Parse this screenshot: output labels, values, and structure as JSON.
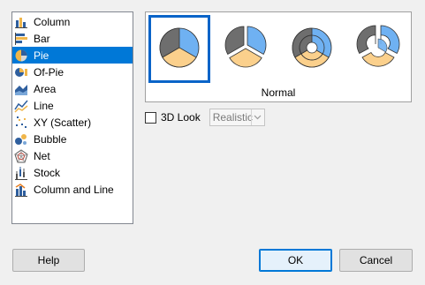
{
  "chart_types": [
    {
      "label": "Column",
      "icon": "column-chart-icon",
      "selected": false
    },
    {
      "label": "Bar",
      "icon": "bar-chart-icon",
      "selected": false
    },
    {
      "label": "Pie",
      "icon": "pie-chart-icon",
      "selected": true
    },
    {
      "label": "Of-Pie",
      "icon": "of-pie-chart-icon",
      "selected": false
    },
    {
      "label": "Area",
      "icon": "area-chart-icon",
      "selected": false
    },
    {
      "label": "Line",
      "icon": "line-chart-icon",
      "selected": false
    },
    {
      "label": "XY (Scatter)",
      "icon": "scatter-chart-icon",
      "selected": false
    },
    {
      "label": "Bubble",
      "icon": "bubble-chart-icon",
      "selected": false
    },
    {
      "label": "Net",
      "icon": "net-chart-icon",
      "selected": false
    },
    {
      "label": "Stock",
      "icon": "stock-chart-icon",
      "selected": false
    },
    {
      "label": "Column and Line",
      "icon": "column-line-chart-icon",
      "selected": false
    }
  ],
  "subtypes": {
    "items": [
      {
        "name": "Normal",
        "icon": "pie-normal-icon",
        "selected": true
      },
      {
        "name": "",
        "icon": "pie-exploded-icon",
        "selected": false
      },
      {
        "name": "",
        "icon": "donut-icon",
        "selected": false
      },
      {
        "name": "",
        "icon": "donut-exploded-icon",
        "selected": false
      }
    ],
    "caption": "Normal"
  },
  "look": {
    "checkbox_label": "3D Look",
    "checked": false,
    "select_value": "Realistic"
  },
  "buttons": {
    "help": "Help",
    "ok": "OK",
    "cancel": "Cancel"
  },
  "colors": {
    "selection": "#0078d7",
    "pie_dark": "#6e6e6e",
    "pie_blue": "#6fb1f2",
    "pie_orange": "#fbd08c"
  }
}
